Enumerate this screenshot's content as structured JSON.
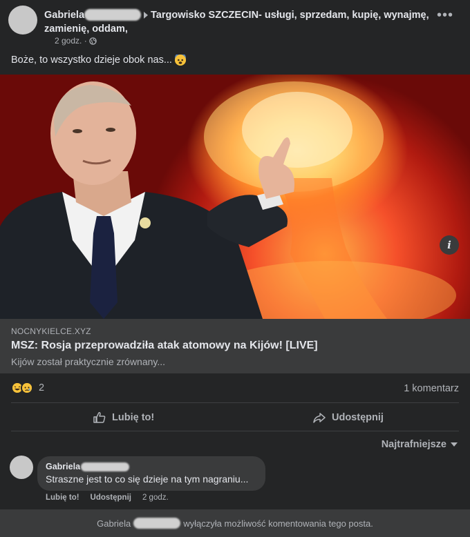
{
  "post": {
    "author": "Gabriela",
    "group": "Targowisko SZCZECIN- usługi, sprzedam, kupię, wynajmę, zamienię, oddam,",
    "time": "2 godz. ·",
    "text": "Boże, to wszystko dzieje obok nas...",
    "emoji_icon": "fearful-face-emoji"
  },
  "link_preview": {
    "domain": "NOCNYKIELCE.XYZ",
    "title": "MSZ: Rosja przeprowadziła atak atomowy na Kijów! [LIVE]",
    "description": "Kijów został praktycznie zrównany...",
    "info_label": "i"
  },
  "stats": {
    "reactions_count": "2",
    "comments_count": "1 komentarz"
  },
  "actions": {
    "like_label": "Lubię to!",
    "share_label": "Udostępnij"
  },
  "comments_sort": "Najtrafniejsze",
  "comment": {
    "author": "Gabriela",
    "text": "Straszne jest to co się dzieje na tym nagraniu...",
    "like_label": "Lubię to!",
    "reply_label": "Udostępnij",
    "time": "2 godz."
  },
  "footer": {
    "author": "Gabriela",
    "text": "wyłączyła możliwość komentowania tego posta."
  },
  "colors": {
    "background": "#242526",
    "surface": "#3a3b3c",
    "text_primary": "#e4e6eb",
    "text_secondary": "#b0b3b8"
  }
}
